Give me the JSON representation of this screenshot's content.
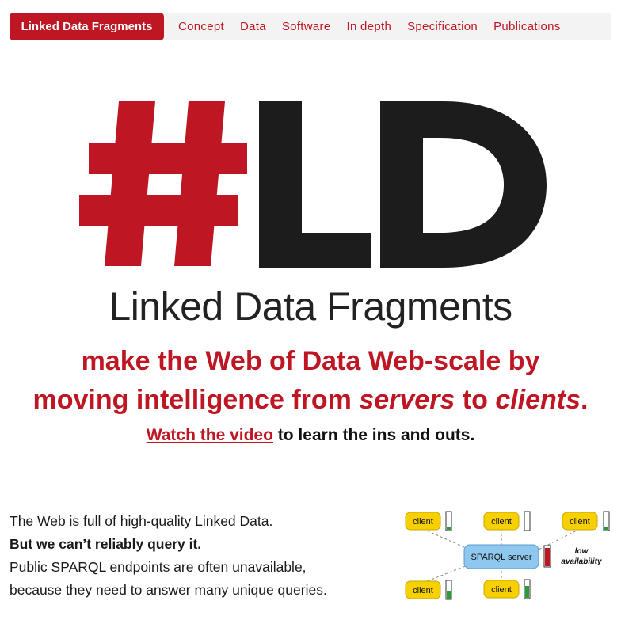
{
  "nav": {
    "brand": "Linked Data Fragments",
    "items": [
      "Concept",
      "Data",
      "Software",
      "In depth",
      "Specification",
      "Publications"
    ]
  },
  "hero": {
    "logo_hash": "#",
    "logo_letters": "LD",
    "title": "Linked Data Fragments",
    "tagline_line1": "make the Web of Data Web-scale by",
    "tagline_line2_a": "moving intelligence from ",
    "tagline_servers": "servers",
    "tagline_to": " to ",
    "tagline_clients": "clients",
    "tagline_end": ".",
    "video_link": "Watch the video",
    "video_rest": " to learn the ins and outs."
  },
  "intro": {
    "line1": "The Web is full of high-quality Linked Data.",
    "line2": "But we can’t reliably query it.",
    "line3": "Public SPARQL endpoints are often unavailable,",
    "line4": "because they need to answer many unique queries."
  },
  "diagram": {
    "client_label": "client",
    "server_label": "SPARQL server",
    "availability_line1": "low",
    "availability_line2": "availability"
  },
  "colors": {
    "accent": "#be1622",
    "client_fill": "#f6d000",
    "server_fill": "#8ec8ee",
    "ok": "#2a9d3a"
  }
}
